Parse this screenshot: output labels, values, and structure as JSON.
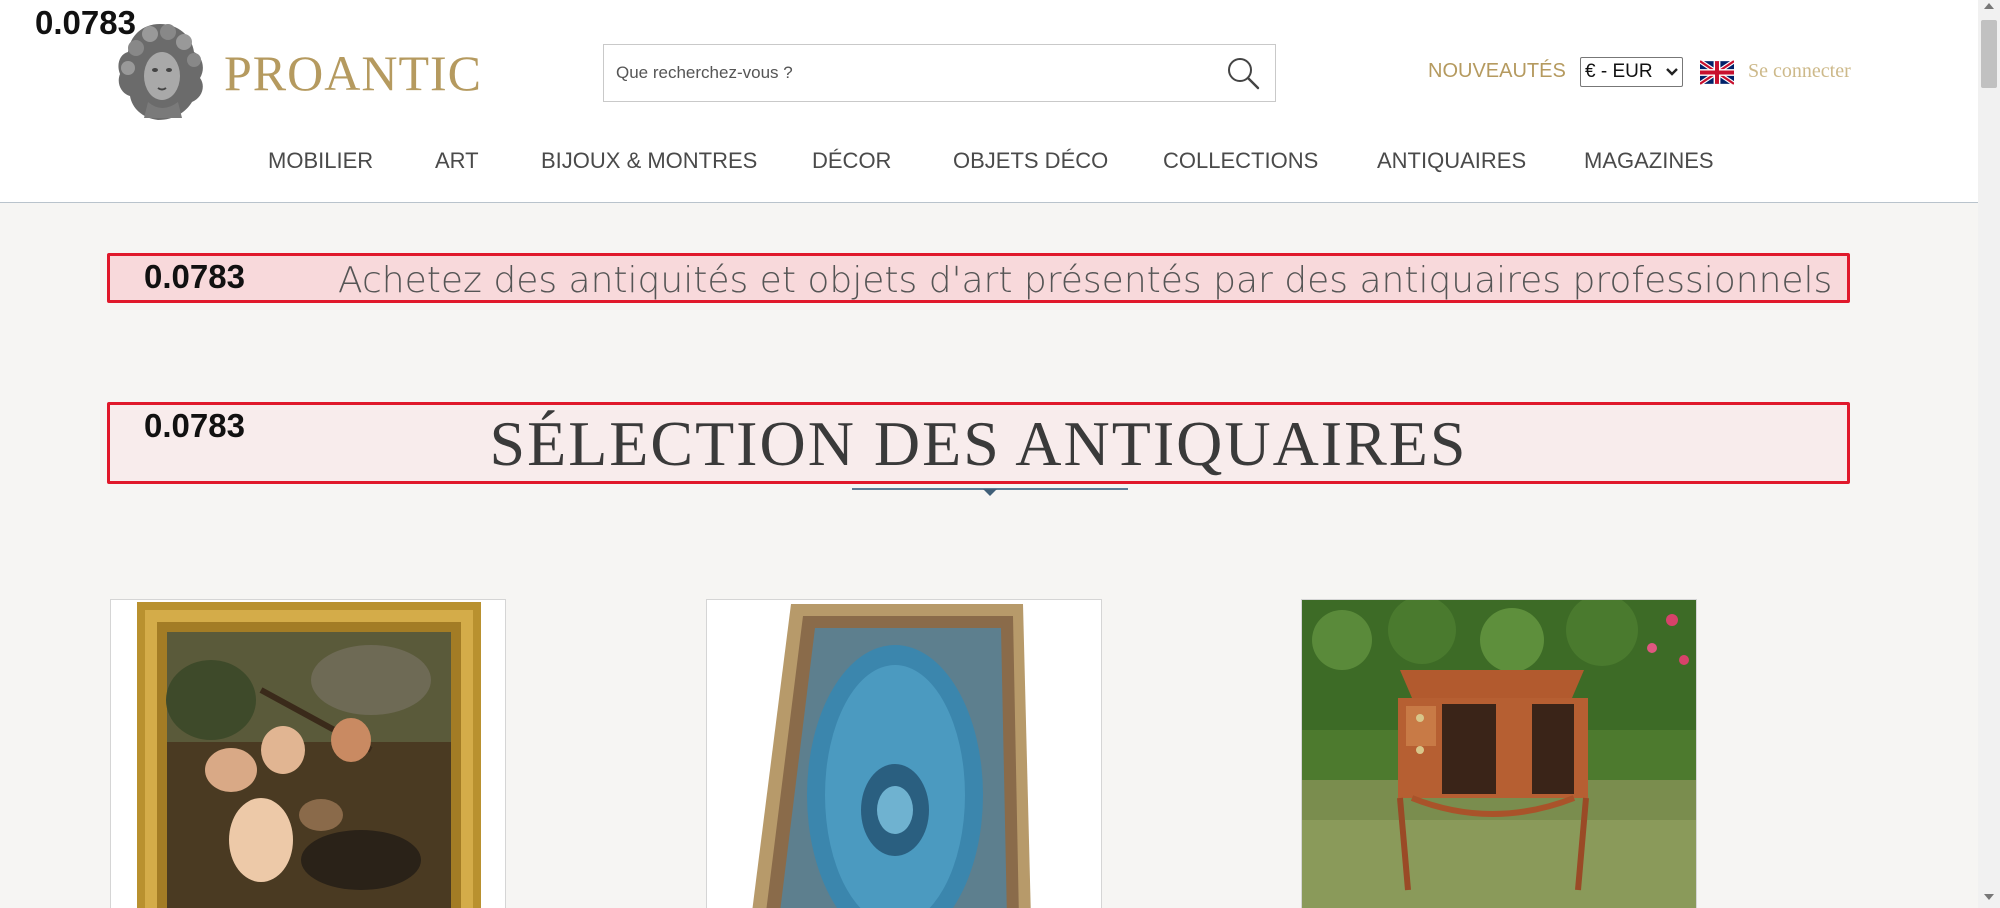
{
  "overlays": {
    "score": "0.0783"
  },
  "header": {
    "logo_text": "PROANTIC",
    "search": {
      "placeholder": "Que recherchez-vous ?"
    },
    "nouveautes": "NOUVEAUTÉS",
    "currency": "€ - EUR",
    "login": "Se connecter"
  },
  "nav": {
    "items": [
      {
        "label": "MOBILIER"
      },
      {
        "label": "ART"
      },
      {
        "label": "BIJOUX & MONTRES"
      },
      {
        "label": "DÉCOR"
      },
      {
        "label": "OBJETS DÉCO"
      },
      {
        "label": "COLLECTIONS"
      },
      {
        "label": "ANTIQUAIRES"
      },
      {
        "label": "MAGAZINES"
      }
    ]
  },
  "main": {
    "tagline": "Achetez des antiquités et objets d'art présentés par des antiquaires professionnels",
    "section_title": "SÉLECTION DES ANTIQUAIRES"
  },
  "colors": {
    "gold": "#b59a5f",
    "highlight_border": "#e0182b",
    "text": "#4a4a4a"
  }
}
